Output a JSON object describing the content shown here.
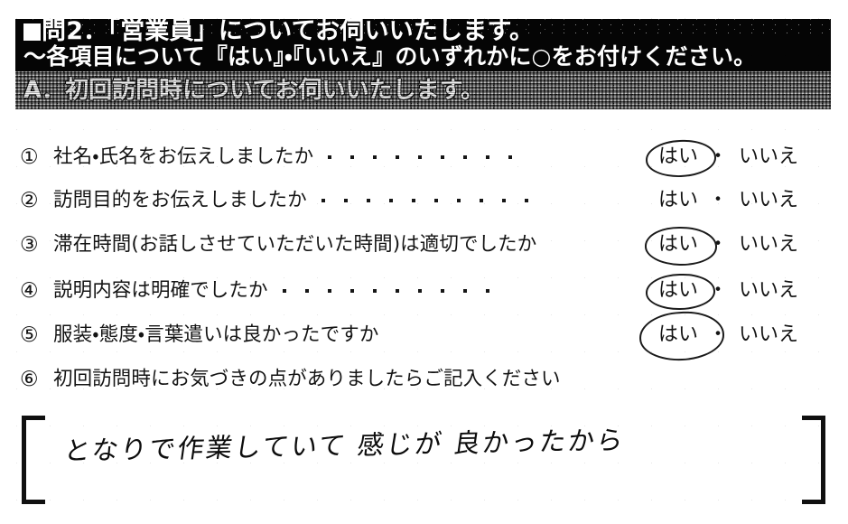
{
  "document": {
    "type": "customer-survey-form",
    "language": "ja"
  },
  "header": {
    "bullet": "■",
    "line1": "問2．「営業員」についてお伺いいたします。",
    "line2": "～各項目について『はい』・『いいえ』のいずれかに○をお付けください。",
    "background_color": "#050505",
    "text_color": "#ffffff"
  },
  "section": {
    "label": "A．初回訪問時についてお伺いいたします。",
    "background_color": "#575757",
    "text_color": "#f2f2f2"
  },
  "answers": {
    "yes_label": "はい",
    "no_label": "いいえ",
    "separator": "・"
  },
  "questions": [
    {
      "number": "①",
      "text": "社名・氏名をお伝えしましたか",
      "leader_dots": 9,
      "selected": "はい",
      "circled": true
    },
    {
      "number": "②",
      "text": "訪問目的をお伝えしましたか",
      "leader_dots": 10,
      "selected": "",
      "circled": false
    },
    {
      "number": "③",
      "text": "滞在時間(お話しさせていただいた時間)は適切でしたか",
      "leader_dots": 0,
      "selected": "はい",
      "circled": true
    },
    {
      "number": "④",
      "text": "説明内容は明確でしたか",
      "leader_dots": 10,
      "selected": "はい",
      "circled": true
    },
    {
      "number": "⑤",
      "text": "服装・態度・言葉遣いは良かったですか",
      "leader_dots": 0,
      "selected": "はい",
      "circled": true
    },
    {
      "number": "⑥",
      "text": "初回訪問時にお気づきの点がありましたらご記入ください",
      "leader_dots": 0,
      "selected": "",
      "circled": false
    }
  ],
  "comment": {
    "bracket_left": "[",
    "bracket_right": "]",
    "handwritten_text": "となりで作業していて 感じが 良かったから"
  }
}
